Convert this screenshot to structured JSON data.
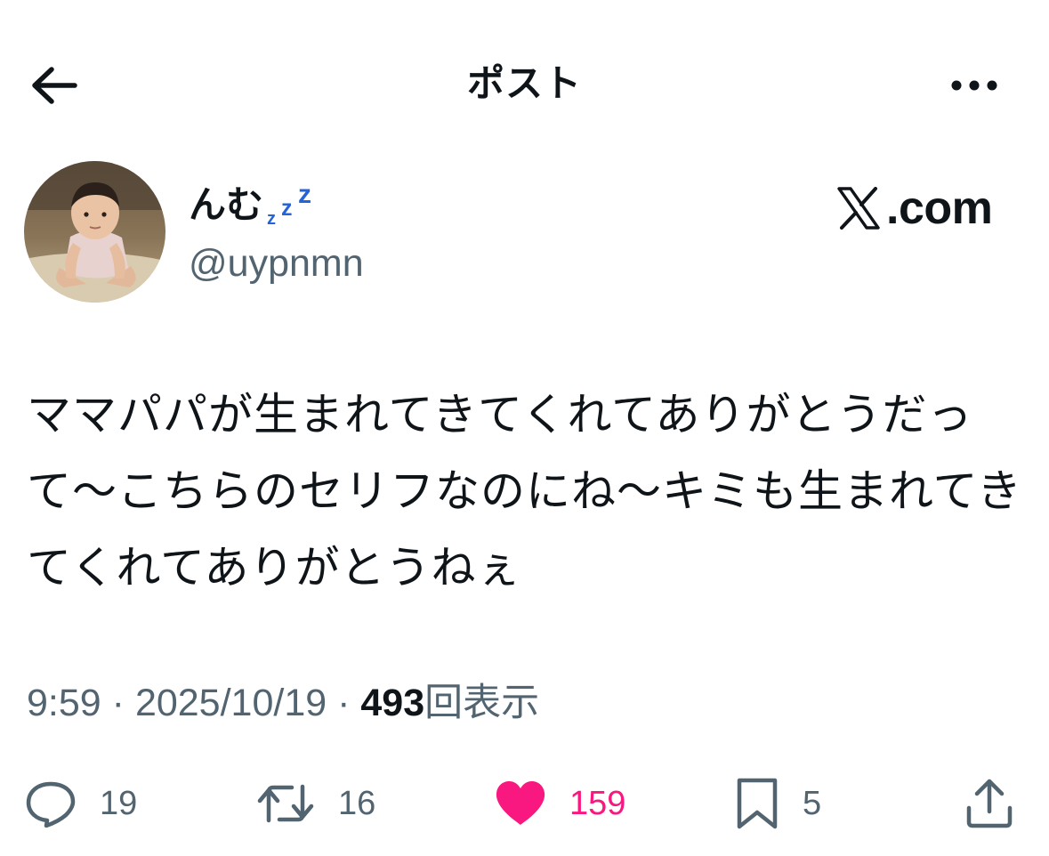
{
  "header": {
    "title": "ポスト",
    "back_icon": "arrow-left-icon",
    "more_icon": "more-horizontal-icon"
  },
  "author": {
    "display_name": "んむ",
    "name_suffix_icon": "zzz-sleeping-icon",
    "handle": "@uypnmn",
    "avatar": "baby-photo-avatar"
  },
  "brand": {
    "logo_icon": "x-logo-icon",
    "text": ".com"
  },
  "post": {
    "text": "ママパパが生まれてきてくれてありがとうだって〜こちらのセリフなのにね〜キミも生まれてきてくれてありがとうねぇ"
  },
  "meta": {
    "time": "9:59",
    "separator": "·",
    "date": "2025/10/19",
    "views_count": "493",
    "views_label": "回表示"
  },
  "actions": {
    "reply": {
      "icon": "reply-icon",
      "count": "19"
    },
    "repost": {
      "icon": "repost-icon",
      "count": "16"
    },
    "like": {
      "icon": "heart-icon",
      "count": "159",
      "active": true
    },
    "bookmark": {
      "icon": "bookmark-icon",
      "count": "5"
    },
    "share": {
      "icon": "share-icon"
    }
  },
  "colors": {
    "text": "#0f1419",
    "secondary": "#536471",
    "like": "#f91880",
    "zzz": "#2563d6"
  }
}
